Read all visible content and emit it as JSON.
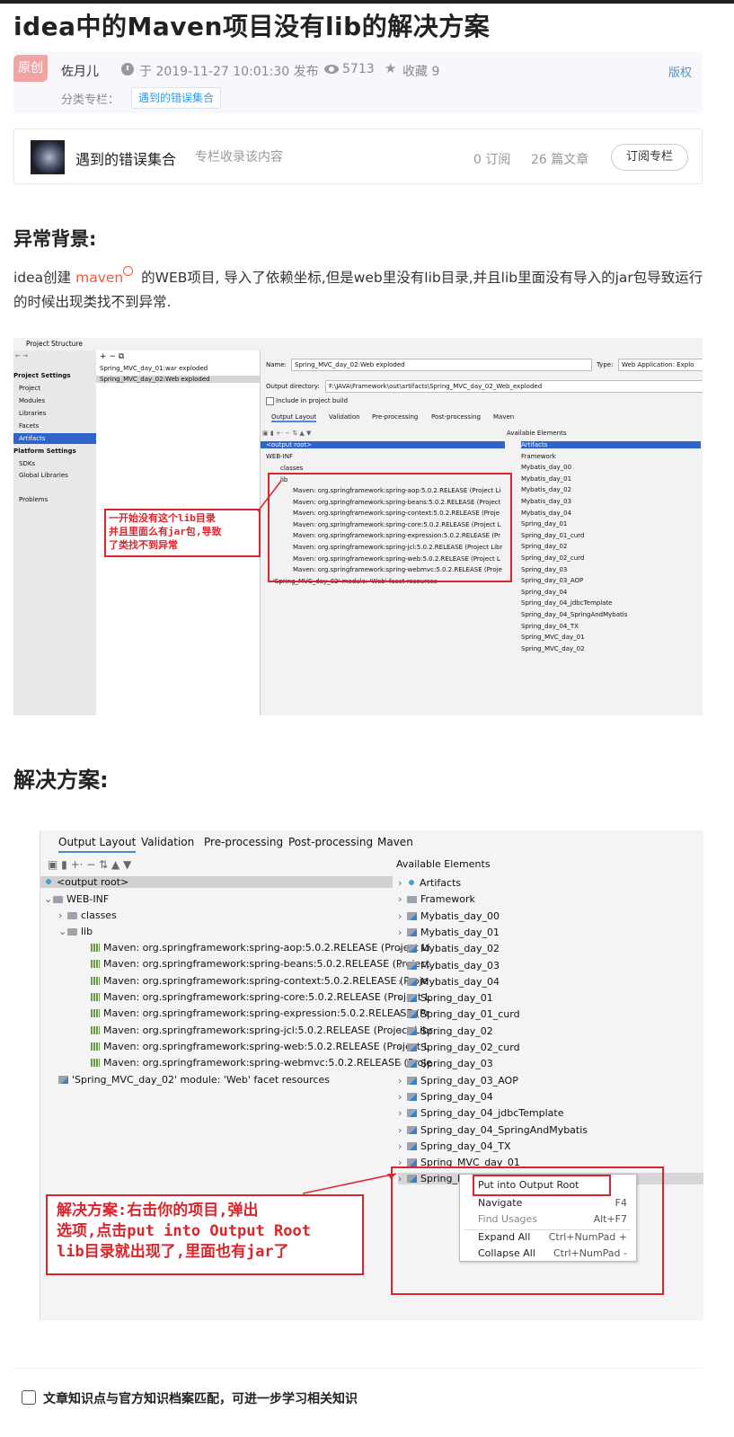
{
  "article": {
    "title": "idea中的Maven项目没有lib的解决方案",
    "original_badge": "原创",
    "author": "佐月儿",
    "publish_time": "于 2019-11-27 10:01:30 发布",
    "views": "5713",
    "favorites": "收藏 9",
    "copyright": "版权",
    "category_label": "分类专栏：",
    "category_tag": "遇到的错误集合"
  },
  "column": {
    "name": "遇到的错误集合",
    "desc": "专栏收录该内容",
    "subscribers": "0 订阅",
    "articles": "26 篇文章",
    "subscribe_button": "订阅专栏"
  },
  "section1": {
    "heading": "异常背景:",
    "text_before_link": "idea创建 ",
    "link_text": "maven",
    "text_after_link": " 的WEB项目, 导入了依赖坐标,但是web里没有lib目录,并且lib里面没有导入的jar包导致运行的时候出现类找不到异常."
  },
  "screenshot1": {
    "window_title": "Project Structure",
    "left_section_project": "Project Settings",
    "left_items": [
      "Project",
      "Modules",
      "Libraries",
      "Facets",
      "Artifacts"
    ],
    "left_section_platform": "Platform Settings",
    "platform_items": [
      "SDKs",
      "Global Libraries"
    ],
    "problems": "Problems",
    "toolbar": "+  −  ⧉",
    "artifacts": [
      "Spring_MVC_day_01:war exploded",
      "Spring_MVC_day_02:Web exploded"
    ],
    "name_label": "Name:",
    "name_value": "Spring_MVC_day_02:Web exploded",
    "type_label": "Type:",
    "type_value": "Web Application: Explo",
    "outdir_label": "Output directory:",
    "outdir_value": "F:\\JAVA\\Framework\\out\\artifacts\\Spring_MVC_day_02_Web_exploded",
    "include_label": "Include in project build",
    "tabs": [
      "Output Layout",
      "Validation",
      "Pre-processing",
      "Post-processing",
      "Maven"
    ],
    "available_label": "Available Elements",
    "tree": [
      "<output root>",
      "WEB-INF",
      "classes",
      "lib"
    ],
    "libs": [
      "Maven: org.springframework:spring-aop:5.0.2.RELEASE (Project Li",
      "Maven: org.springframework:spring-beans:5.0.2.RELEASE (Project",
      "Maven: org.springframework:spring-context:5.0.2.RELEASE (Proje",
      "Maven: org.springframework:spring-core:5.0.2.RELEASE (Project L",
      "Maven: org.springframework:spring-expression:5.0.2.RELEASE (Pr",
      "Maven: org.springframework:spring-jcl:5.0.2.RELEASE (Project Libr",
      "Maven: org.springframework:spring-web:5.0.2.RELEASE (Project L",
      "Maven: org.springframework:spring-webmvc:5.0.2.RELEASE (Proje"
    ],
    "facet": "'Spring_MVC_day_02' module: 'Web' facet resources",
    "annotation": "一开始没有这个lib目录\n并且里面么有jar包,导致\n了类找不到异常"
  },
  "available_elements": [
    "Artifacts",
    "Framework",
    "Mybatis_day_00",
    "Mybatis_day_01",
    "Mybatis_day_02",
    "Mybatis_day_03",
    "Mybatis_day_04",
    "Spring_day_01",
    "Spring_day_01_curd",
    "Spring_day_02",
    "Spring_day_02_curd",
    "Spring_day_03",
    "Spring_day_03_AOP",
    "Spring_day_04",
    "Spring_day_04_jdbcTemplate",
    "Spring_day_04_SpringAndMybatis",
    "Spring_day_04_TX",
    "Spring_MVC_day_01",
    "Spring_MVC_day_02"
  ],
  "section2": {
    "heading": "解决方案:"
  },
  "screenshot2": {
    "context_menu": [
      {
        "label": "Put into Output Root",
        "shortcut": ""
      },
      {
        "label": "Navigate",
        "shortcut": "F4"
      },
      {
        "label": "Find Usages",
        "shortcut": "Alt+F7"
      },
      {
        "label": "Expand All",
        "shortcut": "Ctrl+NumPad +"
      },
      {
        "label": "Collapse All",
        "shortcut": "Ctrl+NumPad -"
      }
    ],
    "annotation": "解决方案:右击你的项目,弹出\n选项,点击put into Output Root\nlib目录就出现了,里面也有jar了"
  },
  "footer": {
    "note": "文章知识点与官方知识档案匹配，可进一步学习相关知识"
  }
}
